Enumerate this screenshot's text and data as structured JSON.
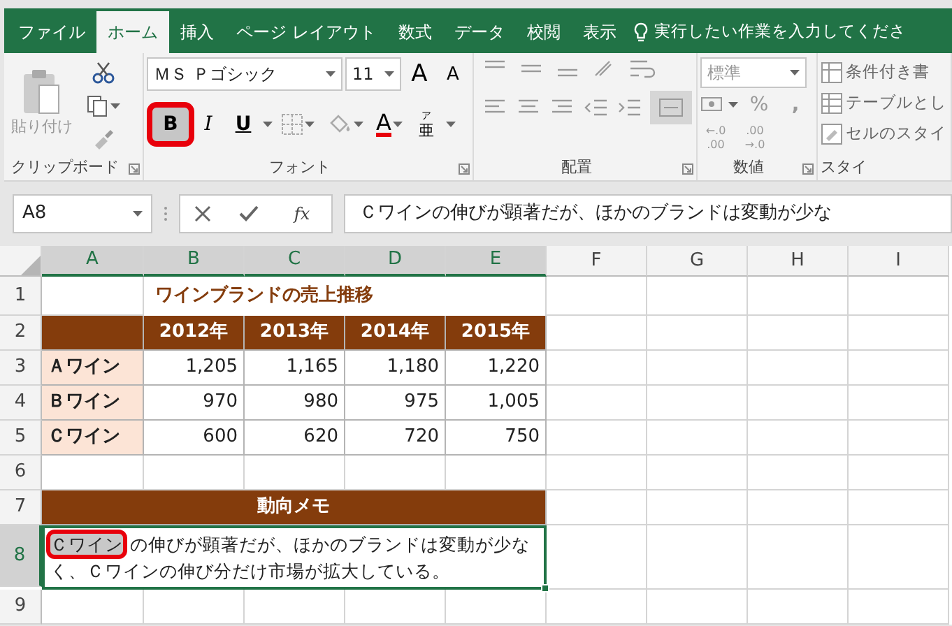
{
  "tabs": [
    {
      "label": "ファイル",
      "selected": false
    },
    {
      "label": "ホーム",
      "selected": true
    },
    {
      "label": "挿入",
      "selected": false
    },
    {
      "label": "ページ レイアウト",
      "selected": false
    },
    {
      "label": "数式",
      "selected": false
    },
    {
      "label": "データ",
      "selected": false
    },
    {
      "label": "校閲",
      "selected": false
    },
    {
      "label": "表示",
      "selected": false
    }
  ],
  "tell_me": "実行したい作業を入力してくださ",
  "ribbon": {
    "clipboard": {
      "label": "クリップボード",
      "paste": "貼り付け"
    },
    "font": {
      "label": "フォント",
      "font_name": "ＭＳ Ｐゴシック",
      "font_size": "11",
      "grow": "A",
      "shrink": "A",
      "bold": {
        "label": "B",
        "highlighted": true
      },
      "italic": "I",
      "underline": "U",
      "font_color": "A",
      "phonetic": [
        "ア",
        "亜"
      ]
    },
    "alignment": {
      "label": "配置"
    },
    "number": {
      "label": "数値",
      "format": "標準",
      "percent": "%",
      "comma": ",",
      "decimals": [
        {
          "top": "←.0",
          "bottom": ".00"
        },
        {
          "top": ".00",
          "bottom": "→.0"
        }
      ]
    },
    "styles": {
      "label": "スタイ",
      "items": [
        "条件付き書",
        "テーブルとし",
        "セルのスタイ"
      ]
    }
  },
  "formula_bar": {
    "name_box": "A8",
    "fx": "fx",
    "formula": "Ｃワインの伸びが顕著だが、ほかのブランドは変動が少な"
  },
  "sheet": {
    "columns": [
      {
        "label": "A",
        "selected": true
      },
      {
        "label": "B",
        "selected": true
      },
      {
        "label": "C",
        "selected": true
      },
      {
        "label": "D",
        "selected": true
      },
      {
        "label": "E",
        "selected": true
      },
      {
        "label": "F",
        "selected": false
      },
      {
        "label": "G",
        "selected": false
      },
      {
        "label": "H",
        "selected": false
      },
      {
        "label": "I",
        "selected": false
      }
    ],
    "rows": [
      {
        "number": "1",
        "selected": false,
        "kind": "title",
        "text": "ワインブランドの売上推移"
      },
      {
        "number": "2",
        "selected": false,
        "kind": "header",
        "cells": [
          "2012年",
          "2013年",
          "2014年",
          "2015年"
        ]
      },
      {
        "number": "3",
        "selected": false,
        "kind": "data",
        "label": "Ａワイン",
        "values": [
          "1,205",
          "1,165",
          "1,180",
          "1,220"
        ]
      },
      {
        "number": "4",
        "selected": false,
        "kind": "data",
        "label": "Ｂワイン",
        "values": [
          "970",
          "980",
          "975",
          "1,005"
        ]
      },
      {
        "number": "5",
        "selected": false,
        "kind": "data",
        "label": "Ｃワイン",
        "values": [
          "600",
          "620",
          "720",
          "750"
        ]
      },
      {
        "number": "6",
        "selected": false,
        "kind": "empty"
      },
      {
        "number": "7",
        "selected": false,
        "kind": "section",
        "text": "動向メモ"
      },
      {
        "number": "8",
        "selected": true,
        "kind": "memo",
        "segments": [
          {
            "text": "Ｃワイン",
            "highlighted": true
          },
          {
            "text": "の伸びが顕著だが、ほかのブランドは変動が少なく、Ｃワインの伸び分だけ市場が拡大している。",
            "highlighted": false
          }
        ]
      },
      {
        "number": "9",
        "selected": false,
        "kind": "empty"
      }
    ]
  }
}
